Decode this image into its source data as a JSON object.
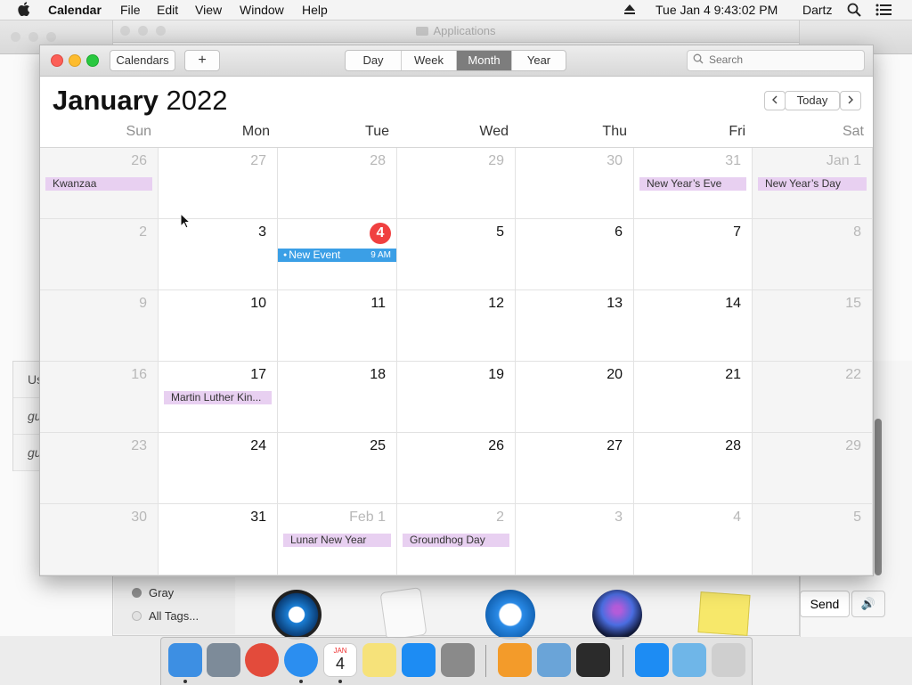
{
  "menubar": {
    "app_name": "Calendar",
    "items": [
      "File",
      "Edit",
      "View",
      "Window",
      "Help"
    ],
    "clock": "Tue Jan 4  9:43:02 PM",
    "user": "Dartz",
    "icons": [
      "apple-icon",
      "eject-icon",
      "search-icon",
      "list-icon"
    ]
  },
  "background": {
    "apps_window_title": "Applications",
    "left_panel_rows": [
      "Us",
      "gu",
      "gu"
    ],
    "tags": [
      {
        "label": "Gray",
        "color": "#8e8e8e"
      },
      {
        "label": "All Tags...",
        "color": "#dcdcdc"
      }
    ],
    "send_label": "Send"
  },
  "calendar": {
    "toolbar": {
      "calendars_label": "Calendars",
      "add_label": "+",
      "views": [
        "Day",
        "Week",
        "Month",
        "Year"
      ],
      "active_view": "Month",
      "search_placeholder": "Search"
    },
    "header": {
      "month": "January",
      "year": "2022",
      "today_label": "Today"
    },
    "weekdays": [
      "Sun",
      "Mon",
      "Tue",
      "Wed",
      "Thu",
      "Fri",
      "Sat"
    ],
    "weeks": [
      [
        {
          "day": "26",
          "dim": true,
          "events": [
            "Kwanzaa"
          ]
        },
        {
          "day": "27",
          "dim": true,
          "events": []
        },
        {
          "day": "28",
          "dim": true,
          "events": []
        },
        {
          "day": "29",
          "dim": true,
          "events": []
        },
        {
          "day": "30",
          "dim": true,
          "events": []
        },
        {
          "day": "31",
          "dim": true,
          "events": [
            "New Year’s Eve"
          ]
        },
        {
          "day": "Jan 1",
          "dim": false,
          "events": [
            "New Year’s Day"
          ]
        }
      ],
      [
        {
          "day": "2",
          "events": []
        },
        {
          "day": "3",
          "events": []
        },
        {
          "day": "4",
          "today": true,
          "events": [],
          "timed_event": {
            "title": "New Event",
            "time": "9 AM"
          }
        },
        {
          "day": "5",
          "events": []
        },
        {
          "day": "6",
          "events": []
        },
        {
          "day": "7",
          "events": []
        },
        {
          "day": "8",
          "events": []
        }
      ],
      [
        {
          "day": "9",
          "events": []
        },
        {
          "day": "10",
          "events": []
        },
        {
          "day": "11",
          "events": []
        },
        {
          "day": "12",
          "events": []
        },
        {
          "day": "13",
          "events": []
        },
        {
          "day": "14",
          "events": []
        },
        {
          "day": "15",
          "events": []
        }
      ],
      [
        {
          "day": "16",
          "events": []
        },
        {
          "day": "17",
          "events": [
            "Martin Luther Kin..."
          ]
        },
        {
          "day": "18",
          "events": []
        },
        {
          "day": "19",
          "events": []
        },
        {
          "day": "20",
          "events": []
        },
        {
          "day": "21",
          "events": []
        },
        {
          "day": "22",
          "events": []
        }
      ],
      [
        {
          "day": "23",
          "events": []
        },
        {
          "day": "24",
          "events": []
        },
        {
          "day": "25",
          "events": []
        },
        {
          "day": "26",
          "events": []
        },
        {
          "day": "27",
          "events": []
        },
        {
          "day": "28",
          "events": []
        },
        {
          "day": "29",
          "events": []
        }
      ],
      [
        {
          "day": "30",
          "events": []
        },
        {
          "day": "31",
          "events": []
        },
        {
          "day": "Feb 1",
          "dim": true,
          "events": [
            "Lunar New Year"
          ]
        },
        {
          "day": "2",
          "dim": true,
          "events": [
            "Groundhog Day"
          ]
        },
        {
          "day": "3",
          "dim": true,
          "events": []
        },
        {
          "day": "4",
          "dim": true,
          "events": []
        },
        {
          "day": "5",
          "dim": true,
          "events": []
        }
      ]
    ],
    "colors": {
      "today": "#f04040",
      "holiday": "#e8d0f1",
      "event": "#3b9fe6"
    }
  },
  "dock": {
    "calendar_icon_month": "JAN",
    "calendar_icon_day": "4",
    "apps": [
      {
        "name": "finder-icon",
        "color": "#3d8fe3",
        "running": true
      },
      {
        "name": "launchpad-icon",
        "color": "#7d8b99",
        "running": false
      },
      {
        "name": "chrome-icon",
        "color": "#e34b3b",
        "running": false
      },
      {
        "name": "safari-icon",
        "color": "#2b8ef0",
        "running": true
      },
      {
        "name": "calendar-icon",
        "color": "#ffffff",
        "running": true
      },
      {
        "name": "notes-icon",
        "color": "#f6e27a",
        "running": false
      },
      {
        "name": "app-store-icon",
        "color": "#1d8cf3",
        "running": false
      },
      {
        "name": "system-preferences-icon",
        "color": "#8a8a8a",
        "running": false
      },
      {
        "name": "home-icon",
        "color": "#f39b2a",
        "running": false
      },
      {
        "name": "preview-icon",
        "color": "#6aa4d8",
        "running": false
      },
      {
        "name": "activity-monitor-icon",
        "color": "#2b2b2b",
        "running": false
      },
      {
        "name": "app-store-icon",
        "color": "#1d8cf3",
        "running": false
      },
      {
        "name": "downloads-folder-icon",
        "color": "#6fb6e8",
        "running": false
      },
      {
        "name": "trash-icon",
        "color": "#cfcfcf",
        "running": false
      }
    ]
  }
}
